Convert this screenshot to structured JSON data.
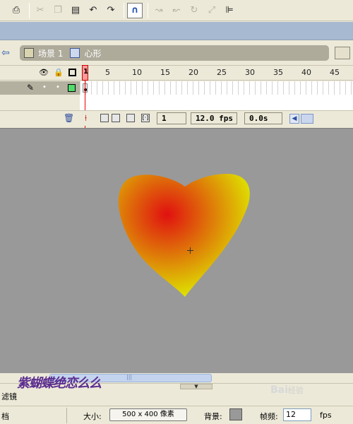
{
  "toolbar": {
    "buttons": [
      "print-icon",
      "cut-icon",
      "copy-icon",
      "paste-icon",
      "undo-icon",
      "redo-icon",
      "snap-magnet-icon",
      "smooth-icon",
      "straighten-icon",
      "rotate-icon",
      "scale-icon",
      "align-icon"
    ]
  },
  "breadcrumb": {
    "scene_label": "场景 1",
    "symbol_label": "心形"
  },
  "timeline": {
    "ruler_numbers": [
      "1",
      "5",
      "10",
      "15",
      "20",
      "25",
      "30",
      "35",
      "40",
      "45"
    ],
    "current_frame": "1",
    "frame_rate": "12.0 fps",
    "elapsed_time": "0.0s",
    "layer_color": "#4fdc6c"
  },
  "stage": {
    "background_color": "#999999",
    "heart_gradient": [
      "#e01010",
      "#ddf000"
    ]
  },
  "panel": {
    "tab_label": "滤镜"
  },
  "properties": {
    "left_label": "档",
    "size_label": "大小:",
    "size_value": "500 x 400 像素",
    "background_label": "背景:",
    "fps_label": "帧频:",
    "fps_value": "12",
    "fps_unit": "fps"
  },
  "watermark": {
    "left_text": "紫蝴蝶绝恋么么",
    "right_text": "Bai",
    "right_sub": "经验"
  }
}
